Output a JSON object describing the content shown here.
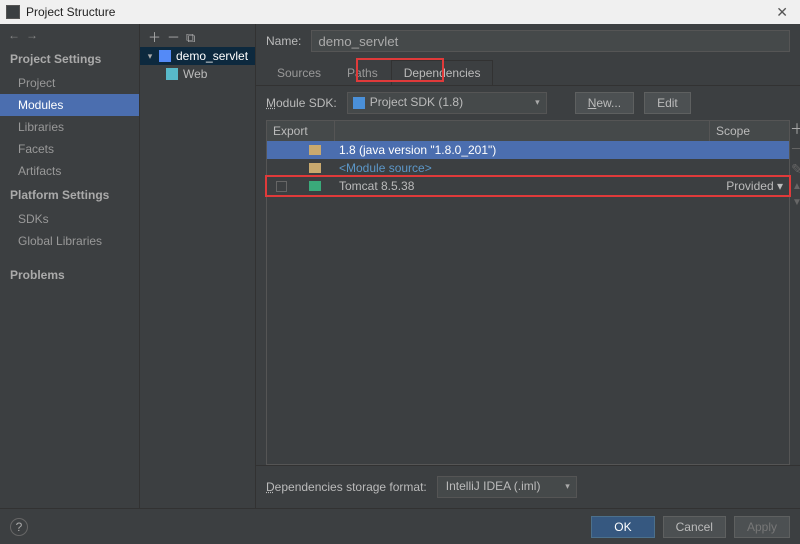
{
  "titlebar": {
    "title": "Project Structure"
  },
  "sidebar": {
    "section1": "Project Settings",
    "items1": [
      "Project",
      "Modules",
      "Libraries",
      "Facets",
      "Artifacts"
    ],
    "selected1": 1,
    "section2": "Platform Settings",
    "items2": [
      "SDKs",
      "Global Libraries"
    ],
    "problems": "Problems"
  },
  "tree": {
    "module": "demo_servlet",
    "child": "Web"
  },
  "main": {
    "name_label": "Name:",
    "name_value": "demo_servlet",
    "tabs": [
      "Sources",
      "Paths",
      "Dependencies"
    ],
    "active_tab": 2,
    "sdk_label": "Module SDK:",
    "sdk_value": "Project SDK (1.8)",
    "btn_new": "New...",
    "btn_edit": "Edit",
    "headers": {
      "export": "Export",
      "scope": "Scope"
    },
    "deps": [
      {
        "icon": "folder",
        "text": "1.8 (java version \"1.8.0_201\")",
        "scope": "",
        "selected": true
      },
      {
        "icon": "folder",
        "text": "<Module source>",
        "link": true,
        "scope": ""
      },
      {
        "icon": "lib",
        "text": "Tomcat 8.5.38",
        "scope": "Provided",
        "checkbox": true,
        "highlighted": true
      }
    ],
    "storage_label": "Dependencies storage format:",
    "storage_value": "IntelliJ IDEA (.iml)"
  },
  "footer": {
    "ok": "OK",
    "cancel": "Cancel",
    "apply": "Apply"
  },
  "icons": {
    "close": "✕",
    "plus": "＋",
    "minus": "－",
    "copy": "⧉",
    "back": "←",
    "fwd": "→",
    "caret_down": "▾",
    "caret_right": "▸",
    "up": "▲",
    "down": "▼",
    "edit": "✎"
  }
}
